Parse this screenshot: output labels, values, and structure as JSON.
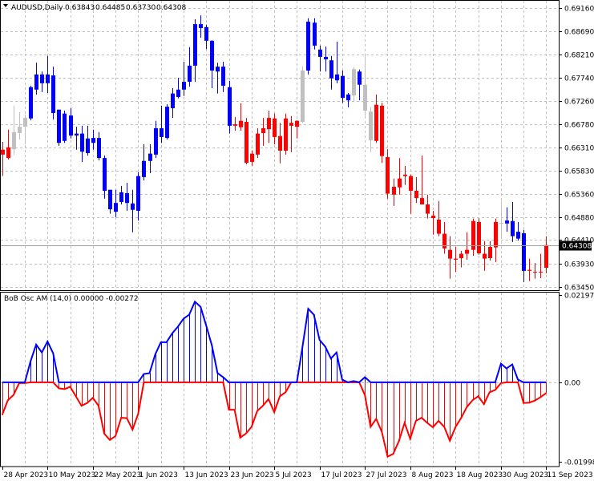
{
  "header": {
    "collapse_icon": "triangle-down-icon",
    "symbol": "AUDUSD,Daily",
    "open": "0.63843",
    "high": "0.64485",
    "low": "0.63730",
    "close": "0.64308"
  },
  "indicator": {
    "label": "BoB Osc AM (14,0) 0.00000 -0.00272"
  },
  "colors": {
    "bull_zone": "#0000ff",
    "bear_zone": "#ff0000",
    "neutral": "#c0c0c0",
    "grid": "#c0c0c0",
    "current_price_box": "#000000"
  },
  "price_axis": {
    "labels": [
      "0.69160",
      "0.68690",
      "0.68210",
      "0.67740",
      "0.67260",
      "0.66780",
      "0.66310",
      "0.65830",
      "0.65360",
      "0.64880",
      "0.64410",
      "0.63930",
      "0.63450"
    ],
    "current_price": "0.64308"
  },
  "osc_axis": {
    "labels": [
      "0.02197",
      "0.00",
      "-0.01998"
    ]
  },
  "time_axis": {
    "labels": [
      "28 Apr 2023",
      "10 May 2023",
      "22 May 2023",
      "1 Jun 2023",
      "13 Jun 2023",
      "23 Jun 2023",
      "5 Jul 2023",
      "17 Jul 2023",
      "27 Jul 2023",
      "8 Aug 2023",
      "18 Aug 2023",
      "30 Aug 2023",
      "11 Sep 2023"
    ]
  },
  "chart_data": [
    {
      "type": "candlestick",
      "title": "AUDUSD,Daily",
      "ylim": [
        0.6345,
        0.6916
      ],
      "grid": true,
      "x_tick_labels": [
        "28 Apr 2023",
        "10 May 2023",
        "22 May 2023",
        "1 Jun 2023",
        "13 Jun 2023",
        "23 Jun 2023",
        "5 Jul 2023",
        "17 Jul 2023",
        "27 Jul 2023",
        "8 Aug 2023",
        "18 Aug 2023",
        "30 Aug 2023",
        "11 Sep 2023"
      ],
      "ohlc": [
        [
          0.6626,
          0.6642,
          0.6572,
          0.6616
        ],
        [
          0.6631,
          0.6667,
          0.6606,
          0.6609
        ],
        [
          0.6627,
          0.6716,
          0.6616,
          0.6662
        ],
        [
          0.666,
          0.6703,
          0.6647,
          0.6673
        ],
        [
          0.6673,
          0.6698,
          0.6637,
          0.6691
        ],
        [
          0.669,
          0.6757,
          0.6686,
          0.6754
        ],
        [
          0.6749,
          0.6804,
          0.6739,
          0.678
        ],
        [
          0.6762,
          0.6786,
          0.6744,
          0.678
        ],
        [
          0.6762,
          0.6818,
          0.6742,
          0.678
        ],
        [
          0.6778,
          0.6796,
          0.6688,
          0.6701
        ],
        [
          0.6708,
          0.6708,
          0.6634,
          0.664
        ],
        [
          0.67,
          0.6706,
          0.664,
          0.6644
        ],
        [
          0.6696,
          0.6711,
          0.6649,
          0.6655
        ],
        [
          0.6659,
          0.6673,
          0.6626,
          0.6655
        ],
        [
          0.6659,
          0.6675,
          0.6601,
          0.6622
        ],
        [
          0.6649,
          0.6675,
          0.6614,
          0.6619
        ],
        [
          0.665,
          0.6667,
          0.6626,
          0.664
        ],
        [
          0.665,
          0.6662,
          0.6604,
          0.6609
        ],
        [
          0.6609,
          0.6614,
          0.6526,
          0.6542
        ],
        [
          0.6544,
          0.6544,
          0.6495,
          0.6504
        ],
        [
          0.6517,
          0.6544,
          0.6488,
          0.6499
        ],
        [
          0.6539,
          0.6552,
          0.6514,
          0.6519
        ],
        [
          0.6537,
          0.6558,
          0.6501,
          0.6517
        ],
        [
          0.6516,
          0.6544,
          0.6457,
          0.6503
        ],
        [
          0.6501,
          0.658,
          0.6481,
          0.6572
        ],
        [
          0.657,
          0.6637,
          0.6563,
          0.6603
        ],
        [
          0.6603,
          0.6637,
          0.6578,
          0.6618
        ],
        [
          0.6616,
          0.6685,
          0.6609,
          0.667
        ],
        [
          0.6652,
          0.6716,
          0.664,
          0.667
        ],
        [
          0.665,
          0.6719,
          0.6647,
          0.6714
        ],
        [
          0.6711,
          0.6752,
          0.6691,
          0.6741
        ],
        [
          0.6734,
          0.6773,
          0.6731,
          0.6749
        ],
        [
          0.6749,
          0.6806,
          0.6736,
          0.6765
        ],
        [
          0.6765,
          0.6836,
          0.6755,
          0.6798
        ],
        [
          0.6798,
          0.6893,
          0.6765,
          0.6883
        ],
        [
          0.6875,
          0.6901,
          0.6855,
          0.6883
        ],
        [
          0.6877,
          0.6882,
          0.6832,
          0.6849
        ],
        [
          0.6849,
          0.685,
          0.6752,
          0.6788
        ],
        [
          0.6796,
          0.6804,
          0.6741,
          0.6786
        ],
        [
          0.6796,
          0.6806,
          0.6744,
          0.6757
        ],
        [
          0.6754,
          0.6767,
          0.6659,
          0.6675
        ],
        [
          0.6678,
          0.6693,
          0.6665,
          0.6675
        ],
        [
          0.6685,
          0.6721,
          0.6665,
          0.6672
        ],
        [
          0.6683,
          0.6691,
          0.6596,
          0.6599
        ],
        [
          0.6618,
          0.6624,
          0.6593,
          0.6601
        ],
        [
          0.6616,
          0.667,
          0.6609,
          0.6659
        ],
        [
          0.666,
          0.6691,
          0.6634,
          0.667
        ],
        [
          0.6668,
          0.6706,
          0.664,
          0.6691
        ],
        [
          0.669,
          0.67,
          0.6637,
          0.6652
        ],
        [
          0.6654,
          0.6681,
          0.6598,
          0.6624
        ],
        [
          0.6624,
          0.67,
          0.6616,
          0.669
        ],
        [
          0.6681,
          0.6695,
          0.6621,
          0.6675
        ],
        [
          0.6673,
          0.6686,
          0.6649,
          0.6685
        ],
        [
          0.6683,
          0.6796,
          0.6681,
          0.6788
        ],
        [
          0.6788,
          0.6895,
          0.678,
          0.6888
        ],
        [
          0.6886,
          0.6895,
          0.6831,
          0.6839
        ],
        [
          0.6831,
          0.6839,
          0.6786,
          0.6816
        ],
        [
          0.6816,
          0.6837,
          0.6786,
          0.6811
        ],
        [
          0.6809,
          0.6818,
          0.6749,
          0.6772
        ],
        [
          0.678,
          0.6847,
          0.6762,
          0.6768
        ],
        [
          0.6777,
          0.6788,
          0.6722,
          0.6732
        ],
        [
          0.6727,
          0.6742,
          0.6713,
          0.6739
        ],
        [
          0.6737,
          0.6795,
          0.6724,
          0.6791
        ],
        [
          0.6786,
          0.679,
          0.6727,
          0.6759
        ],
        [
          0.6759,
          0.6823,
          0.6695,
          0.6706
        ],
        [
          0.6704,
          0.6714,
          0.6621,
          0.6645
        ],
        [
          0.6644,
          0.6739,
          0.664,
          0.6718
        ],
        [
          0.6716,
          0.6722,
          0.6599,
          0.6613
        ],
        [
          0.6611,
          0.6627,
          0.6526,
          0.6536
        ],
        [
          0.655,
          0.6567,
          0.6511,
          0.6534
        ],
        [
          0.6549,
          0.6609,
          0.6534,
          0.6567
        ],
        [
          0.6575,
          0.6593,
          0.6554,
          0.6572
        ],
        [
          0.6572,
          0.6575,
          0.6495,
          0.6542
        ],
        [
          0.6542,
          0.657,
          0.6517,
          0.6527
        ],
        [
          0.6527,
          0.6614,
          0.6514,
          0.6514
        ],
        [
          0.6514,
          0.6534,
          0.6485,
          0.6495
        ],
        [
          0.6491,
          0.6501,
          0.6452,
          0.6486
        ],
        [
          0.6483,
          0.6521,
          0.6449,
          0.6454
        ],
        [
          0.6454,
          0.6478,
          0.6413,
          0.6424
        ],
        [
          0.6421,
          0.6449,
          0.6362,
          0.6403
        ],
        [
          0.6403,
          0.6427,
          0.6376,
          0.6401
        ],
        [
          0.6404,
          0.6419,
          0.6385,
          0.6413
        ],
        [
          0.6413,
          0.6457,
          0.6401,
          0.6421
        ],
        [
          0.6421,
          0.6485,
          0.6409,
          0.648
        ],
        [
          0.6478,
          0.6486,
          0.6411,
          0.6414
        ],
        [
          0.6413,
          0.6439,
          0.6378,
          0.6403
        ],
        [
          0.6404,
          0.6439,
          0.6399,
          0.6427
        ],
        [
          0.6426,
          0.6485,
          0.6396,
          0.6478
        ],
        [
          0.6475,
          0.6521,
          0.6445,
          0.6476
        ],
        [
          0.6475,
          0.6508,
          0.6458,
          0.6481
        ],
        [
          0.648,
          0.6519,
          0.6437,
          0.6449
        ],
        [
          0.6458,
          0.6478,
          0.644,
          0.6444
        ],
        [
          0.6455,
          0.6462,
          0.6355,
          0.6378
        ],
        [
          0.638,
          0.6403,
          0.6357,
          0.6378
        ],
        [
          0.6376,
          0.6394,
          0.6362,
          0.6375
        ],
        [
          0.6376,
          0.6413,
          0.6363,
          0.6375
        ],
        [
          0.63843,
          0.64485,
          0.6373,
          0.64308
        ]
      ],
      "bar_colors": "rrgggbbbbbbbbbbbbbbbbbbbbbbbbbbbbbbbbbbbbrrrrrrrrrrrrgbbbbbbbbgbggrrrrrrrrrrrrrrrrrrrrrrgbbbbrrrrr"
    },
    {
      "type": "histogram-line",
      "title": "BoB Osc AM (14,0)",
      "ylim": [
        -0.01998,
        0.02197
      ],
      "grid": true,
      "series": [
        {
          "color": "#0000ff",
          "values": [
            0,
            0,
            0,
            0,
            0,
            0.0053,
            0.0095,
            0.0075,
            0.0103,
            0.0073,
            0,
            0,
            0,
            0,
            0,
            0,
            0,
            0,
            0,
            0,
            0,
            0,
            0,
            0,
            0,
            0.0021,
            0.0023,
            0.007,
            0.0101,
            0.0101,
            0.0123,
            0.014,
            0.016,
            0.017,
            0.0203,
            0.019,
            0.0143,
            0.0093,
            0.0023,
            0.0013,
            0,
            0,
            0,
            0,
            0,
            0,
            0,
            0,
            0,
            0,
            0,
            0,
            0,
            0.009,
            0.0185,
            0.017,
            0.0107,
            0.009,
            0.006,
            0.0075,
            0.0007,
            0,
            0.0003,
            0,
            0.0013,
            0,
            0,
            0,
            0,
            0,
            0,
            0,
            0,
            0,
            0,
            0,
            0,
            0,
            0,
            0,
            0,
            0,
            0,
            0,
            0,
            0,
            0,
            0,
            0.0047,
            0.0035,
            0.0045,
            0.0007,
            0,
            0,
            0,
            0,
            0
          ]
        },
        {
          "color": "#ff0000",
          "values": [
            -0.0082,
            -0.0045,
            -0.0032,
            -0.0002,
            -0.0002,
            0,
            0,
            0,
            0,
            0,
            -0.0015,
            -0.0017,
            -0.0011,
            -0.0035,
            -0.0059,
            -0.0052,
            -0.0039,
            -0.0059,
            -0.0129,
            -0.0145,
            -0.0135,
            -0.0089,
            -0.009,
            -0.0119,
            -0.0079,
            0,
            0,
            0,
            0,
            0,
            0,
            0,
            0,
            0,
            0,
            0,
            0,
            0,
            0,
            0,
            -0.0069,
            -0.0069,
            -0.0139,
            -0.0129,
            -0.0112,
            -0.0072,
            -0.0059,
            -0.0042,
            -0.0075,
            -0.0035,
            -0.0025,
            0,
            0,
            0,
            0,
            0,
            0,
            0,
            0,
            0,
            0,
            0,
            0,
            0,
            -0.0032,
            -0.0112,
            -0.0092,
            -0.0125,
            -0.0187,
            -0.018,
            -0.0148,
            -0.0102,
            -0.0142,
            -0.0097,
            -0.0089,
            -0.0102,
            -0.0113,
            -0.0097,
            -0.0112,
            -0.0147,
            -0.0112,
            -0.0089,
            -0.0062,
            -0.0045,
            -0.0035,
            -0.0055,
            -0.0025,
            -0.0019,
            -0.0002,
            0,
            0,
            0,
            -0.0052,
            -0.0051,
            -0.0046,
            -0.0037,
            -0.0027
          ]
        }
      ]
    }
  ]
}
